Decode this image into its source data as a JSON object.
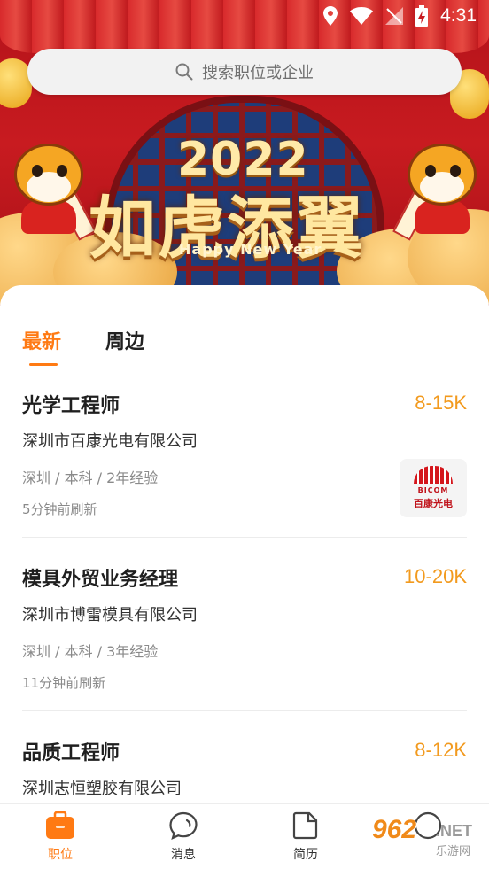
{
  "status_bar": {
    "time": "4:31"
  },
  "search": {
    "placeholder": "搜索职位或企业",
    "icon": "search-icon"
  },
  "banner": {
    "year": "2022",
    "slogan": "如虎添翼",
    "slogan_en": "Happy New Year"
  },
  "tabs": [
    {
      "label": "最新",
      "active": true
    },
    {
      "label": "周边",
      "active": false
    }
  ],
  "jobs": [
    {
      "title": "光学工程师",
      "salary": "8-15K",
      "company": "深圳市百康光电有限公司",
      "meta": "深圳 / 本科 / 2年经验",
      "updated": "5分钟前刷新",
      "logo": {
        "en": "BICOM",
        "cn": "百康光电"
      }
    },
    {
      "title": "模具外贸业务经理",
      "salary": "10-20K",
      "company": "深圳市博雷模具有限公司",
      "meta": "深圳 / 本科 / 3年经验",
      "updated": "11分钟前刷新"
    },
    {
      "title": "品质工程师",
      "salary": "8-12K",
      "company": "深圳志恒塑胶有限公司"
    }
  ],
  "bottom_nav": [
    {
      "label": "职位",
      "icon": "briefcase-icon",
      "active": true
    },
    {
      "label": "消息",
      "icon": "chat-bubble-icon",
      "active": false
    },
    {
      "label": "简历",
      "icon": "document-icon",
      "active": false
    }
  ],
  "watermark": {
    "num": "962",
    "net": ".NET",
    "cn": "乐游网"
  },
  "colors": {
    "accent": "#ff7a13",
    "salary": "#f29a1e",
    "banner_red": "#c81b20"
  }
}
